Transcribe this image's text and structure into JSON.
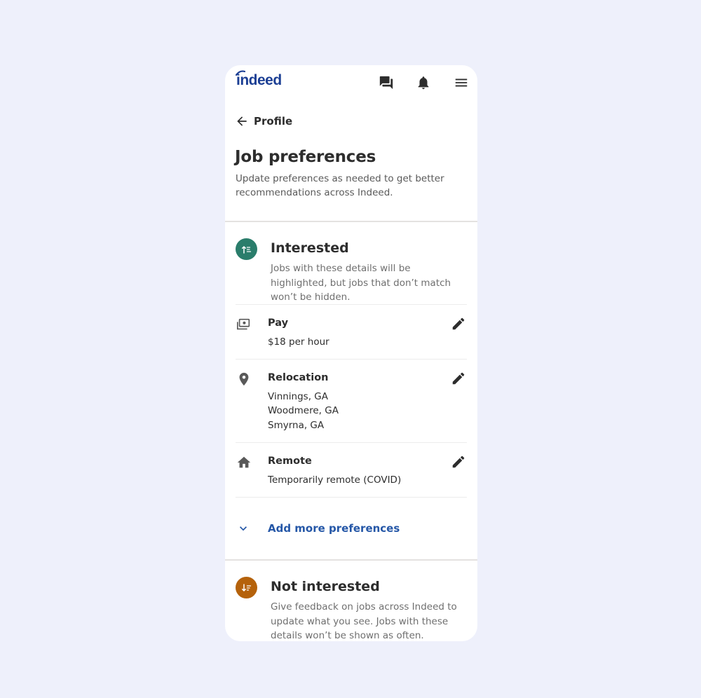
{
  "brand": {
    "logo_text": "indeed",
    "color": "#1c3f94"
  },
  "header": {
    "icons": [
      "messages-icon",
      "notifications-icon",
      "menu-icon"
    ]
  },
  "nav": {
    "back_label": "Profile"
  },
  "page": {
    "title": "Job preferences",
    "subtitle": "Update preferences as needed to get better recommendations across Indeed."
  },
  "interested": {
    "title": "Interested",
    "description": "Jobs with these details will be highlighted, but jobs that don’t match won’t be hidden.",
    "badge_color": "#2a7d6b",
    "items": [
      {
        "icon": "pay-icon",
        "label": "Pay",
        "values": [
          "$18 per hour"
        ]
      },
      {
        "icon": "location-pin-icon",
        "label": "Relocation",
        "values": [
          "Vinnings, GA",
          "Woodmere, GA",
          "Smyrna, GA"
        ]
      },
      {
        "icon": "home-icon",
        "label": "Remote",
        "values": [
          "Temporarily remote (COVID)"
        ]
      }
    ],
    "add_more_label": "Add more preferences"
  },
  "not_interested": {
    "title": "Not interested",
    "description": "Give feedback on jobs across Indeed to update what you see. Jobs with these details won’t be shown as often.",
    "badge_color": "#b5620b"
  },
  "colors": {
    "background": "#eef0fb",
    "link": "#2557a7",
    "text": "#2d2d2d",
    "muted": "#6f6f6f"
  }
}
